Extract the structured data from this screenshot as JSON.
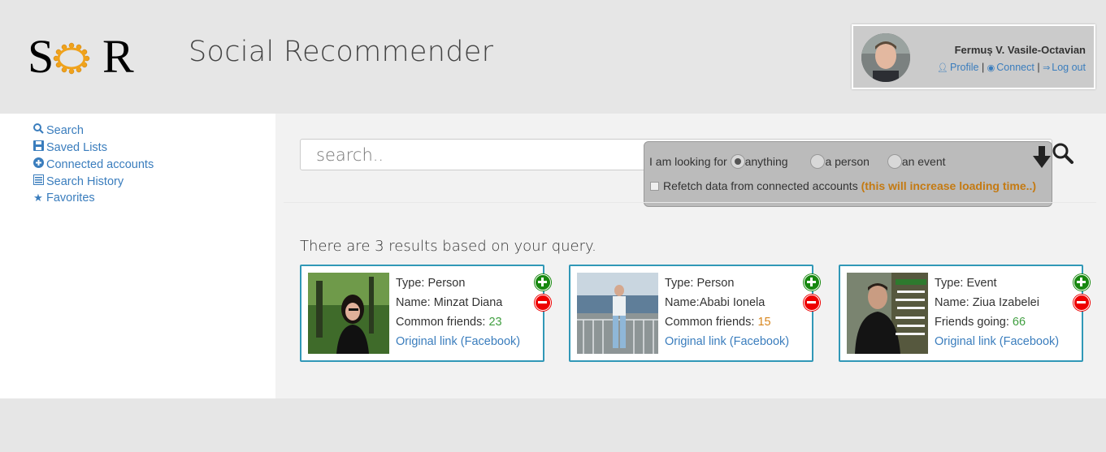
{
  "header": {
    "logo_left": "S",
    "logo_right": "R",
    "title": "Social Recommender"
  },
  "user": {
    "name": "Fermuș V. Vasile-Octavian",
    "links": [
      {
        "label": "Profile",
        "icon": "user-icon"
      },
      {
        "label": "Connect",
        "icon": "eye-icon"
      },
      {
        "label": "Log out",
        "icon": "logout-icon"
      }
    ],
    "separator": "|"
  },
  "sidebar": {
    "items": [
      {
        "label": "Search",
        "icon": "search-icon"
      },
      {
        "label": "Saved Lists",
        "icon": "save-icon"
      },
      {
        "label": "Connected accounts",
        "icon": "plus-circle-icon"
      },
      {
        "label": "Search History",
        "icon": "list-icon"
      },
      {
        "label": "Favorites",
        "icon": "star-icon"
      }
    ]
  },
  "search": {
    "placeholder": "search.."
  },
  "options": {
    "looking_for_label": "I am looking for",
    "radios": [
      {
        "label": "anything",
        "checked": true
      },
      {
        "label": "a person",
        "checked": false
      },
      {
        "label": "an event",
        "checked": false
      }
    ],
    "refetch_label": "Refetch data from connected accounts",
    "refetch_warning": "(this will increase loading time..)"
  },
  "results": {
    "summary": "There are 3 results based on your query.",
    "cards": [
      {
        "type": "Type: Person",
        "name": "Name: Minzat Diana",
        "stat_label": "Common friends: ",
        "stat_value": "23",
        "link": "Original link (Facebook)"
      },
      {
        "type": "Type: Person",
        "name": "Name:Ababi Ionela",
        "stat_label": "Common friends: ",
        "stat_value": "15",
        "link": "Original link (Facebook)"
      },
      {
        "type": "Type: Event",
        "name": "Name: Ziua Izabelei",
        "stat_label": "Friends going: ",
        "stat_value": "66",
        "link": "Original link (Facebook)"
      }
    ]
  },
  "colors": {
    "accent": "#3a7dbd",
    "card_border": "#3198b7",
    "add": "#17880f",
    "remove": "#ee0000",
    "warning": "#c47a12"
  }
}
